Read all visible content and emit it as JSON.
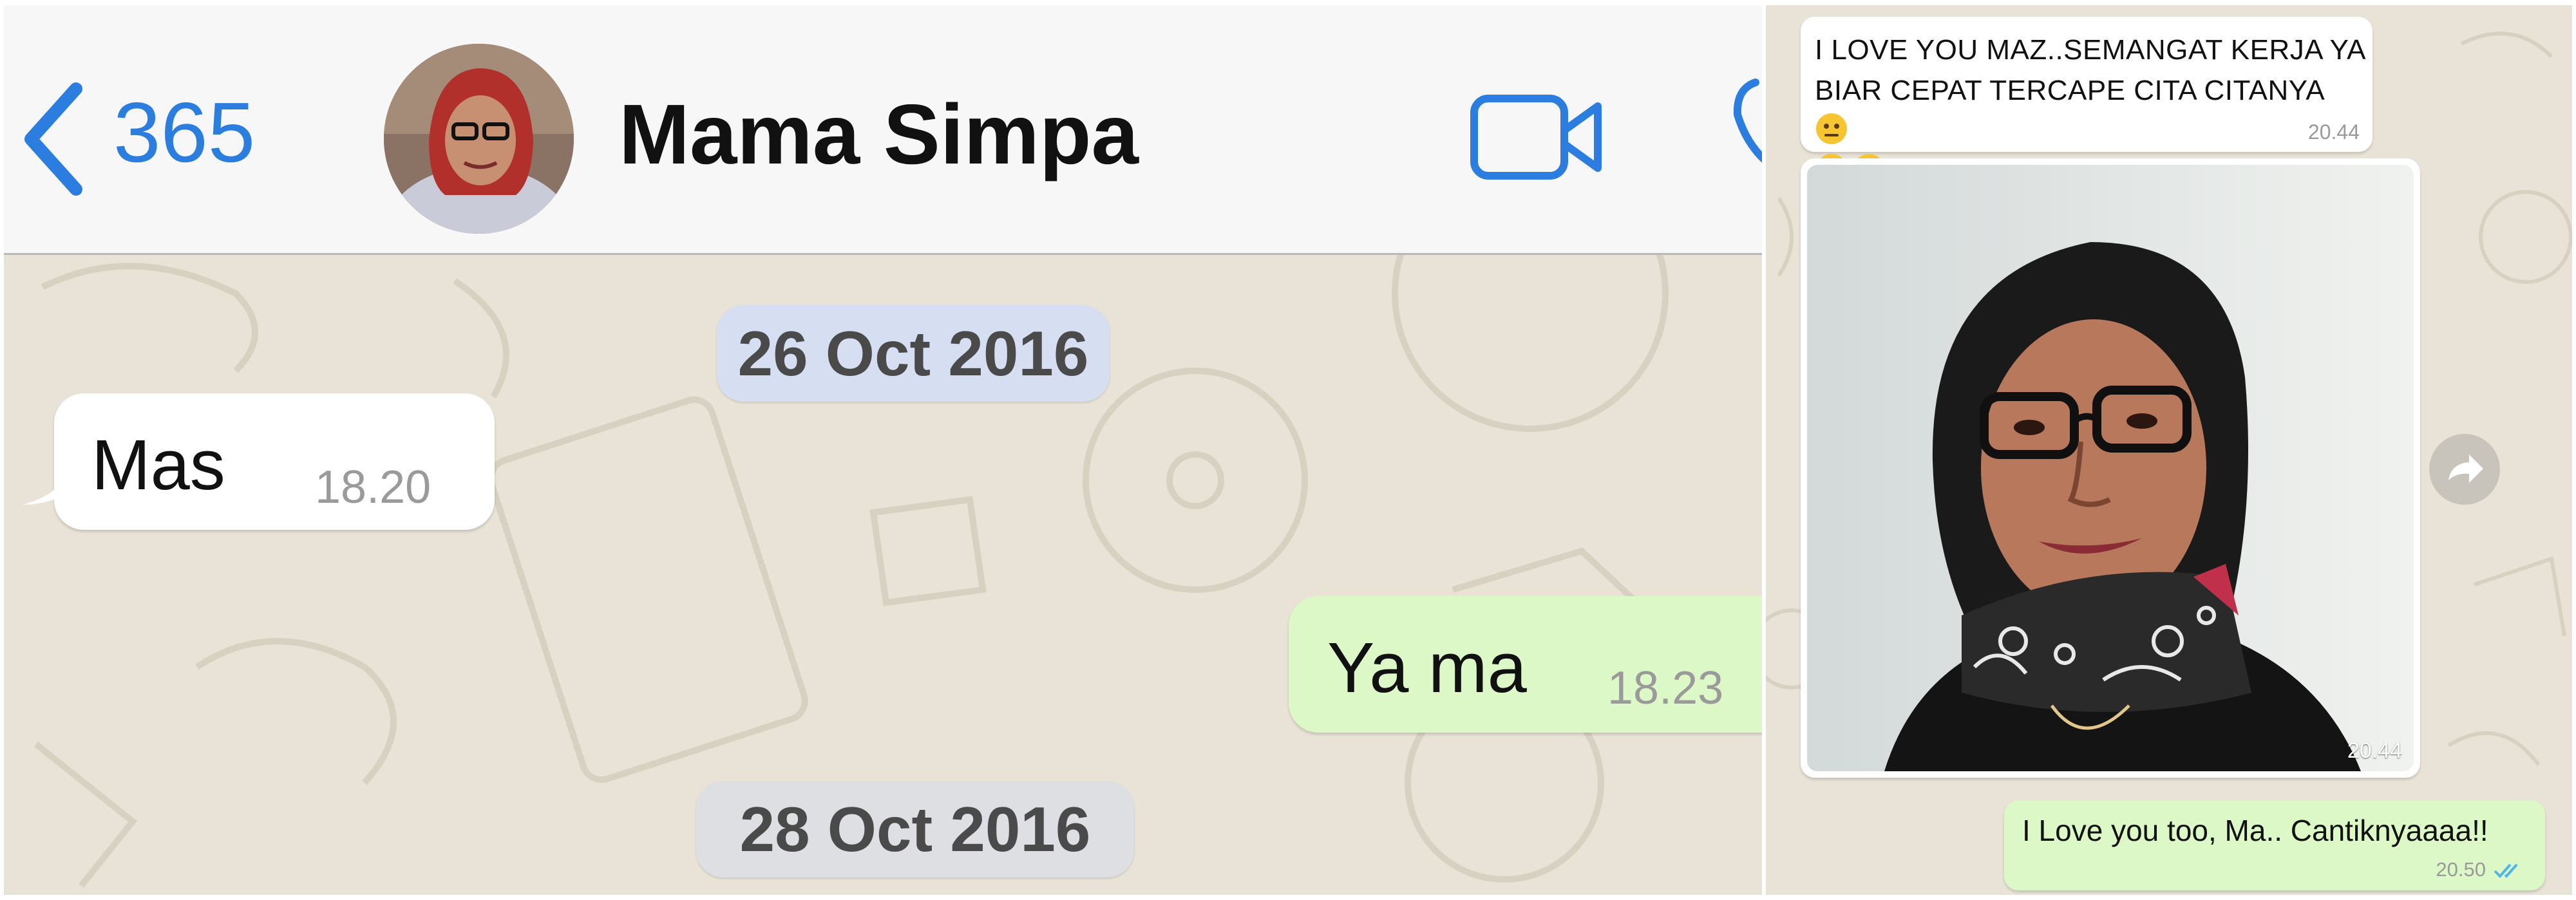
{
  "left": {
    "header": {
      "back_count": "365",
      "contact_name": "Mama Simpa"
    },
    "dates": [
      "26 Oct 2016",
      "28 Oct 2016"
    ],
    "messages": [
      {
        "text": "Mas",
        "time": "18.20",
        "direction": "incoming"
      },
      {
        "text": "Ya ma",
        "time": "18.23",
        "direction": "outgoing"
      }
    ]
  },
  "right": {
    "messages": [
      {
        "text": "I LOVE YOU MAZ..SEMANGAT KERJA YA BIAR CEPAT TERCAPE CITA CITANYA",
        "emoji": "neutral-face-emoji",
        "time": "20.44",
        "direction": "incoming"
      },
      {
        "type": "photo",
        "time": "20.44",
        "direction": "incoming"
      },
      {
        "text": "I Love you too, Ma.. Cantiknyaaaa!!",
        "time": "20.50",
        "direction": "outgoing",
        "status": "read"
      }
    ]
  },
  "colors": {
    "accent": "#2b7de0",
    "outgoing_bubble": "#dcf8c6",
    "incoming_bubble": "#ffffff",
    "chat_background": "#e8e3d6",
    "read_ticks": "#4fb6ec"
  }
}
